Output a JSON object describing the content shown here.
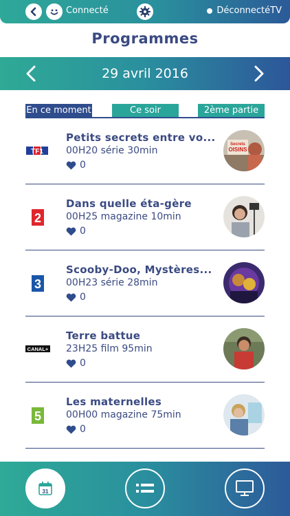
{
  "topbar": {
    "connected_label": "Connecté",
    "disconnect_label": "DéconnectéTV"
  },
  "page": {
    "title": "Programmes"
  },
  "datebar": {
    "date": "29 avril 2016"
  },
  "tabs": [
    {
      "label": "En ce moment",
      "active": true
    },
    {
      "label": "Ce soir",
      "active": false
    },
    {
      "label": "2ème partie",
      "active": false
    }
  ],
  "programs": [
    {
      "channel": "TF1",
      "title": "Petits secrets entre vo...",
      "info": "00H20 série 30min",
      "likes": "0",
      "thumb_text": "Secrets OISINS"
    },
    {
      "channel": "France 2",
      "title": "Dans quelle éta-gère",
      "info": "00H25 magazine 10min",
      "likes": "0"
    },
    {
      "channel": "France 3",
      "title": "Scooby-Doo, Mystères...",
      "info": "00H23 série 28min",
      "likes": "0"
    },
    {
      "channel": "CANAL+",
      "title": "Terre battue",
      "info": "23H25 film 95min",
      "likes": "0"
    },
    {
      "channel": "France 5",
      "title": "Les maternelles",
      "info": "00H00 magazine 75min",
      "likes": "0"
    }
  ],
  "logos": {
    "tf1": "TF1",
    "f2": "2",
    "f3": "3",
    "canal": "CANAL+",
    "f5": "5"
  },
  "bottom_nav": {
    "calendar_day": "31"
  },
  "colors": {
    "accent_teal": "#2aa59a",
    "accent_navy": "#2f4c8c",
    "text": "#3a4a82"
  },
  "icons": [
    "back-arrow-icon",
    "smiley-icon",
    "gear-icon",
    "chevron-left-icon",
    "chevron-right-icon",
    "heart-icon",
    "calendar-icon",
    "list-icon",
    "tv-icon"
  ]
}
